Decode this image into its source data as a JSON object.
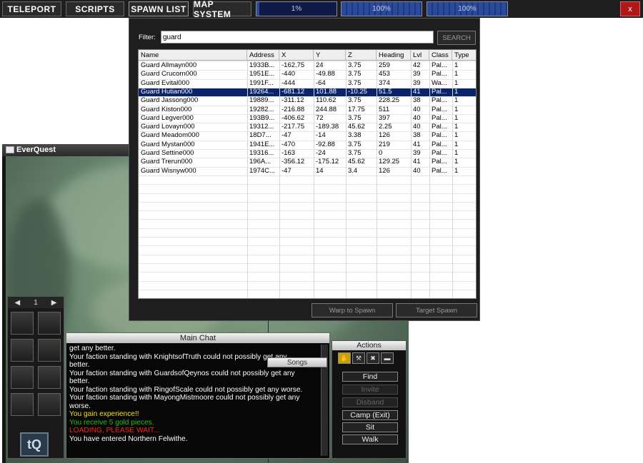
{
  "topbar": {
    "buttons": [
      "TELEPORT",
      "SCRIPTS",
      "SPAWN LIST",
      "MAP SYSTEM"
    ],
    "progress": [
      {
        "label": "1%",
        "value": 0.01
      },
      {
        "label": "100%",
        "value": 1.0
      },
      {
        "label": "100%",
        "value": 1.0
      }
    ],
    "close_label": "x"
  },
  "spawn_list": {
    "filter_label": "Filter:",
    "filter_value": "guard",
    "search_label": "SEARCH",
    "columns": [
      "Name",
      "Address",
      "X",
      "Y",
      "Z",
      "Heading",
      "Lvl",
      "Class",
      "Type"
    ],
    "selected_index": 3,
    "rows": [
      [
        "Guard Allmayn000",
        "1933B...",
        "-162.75",
        "24",
        "3.75",
        "259",
        "42",
        "Pal...",
        "1"
      ],
      [
        "Guard Crucorn000",
        "1951E...",
        "-440",
        "-49.88",
        "3.75",
        "453",
        "39",
        "Pal...",
        "1"
      ],
      [
        "Guard Evital000",
        "1991F...",
        "-444",
        "-64",
        "3.75",
        "374",
        "39",
        "Wa...",
        "1"
      ],
      [
        "Guard Hutian000",
        "19264...",
        "-681.12",
        "101.88",
        "-10.25",
        "51.5",
        "41",
        "Pal...",
        "1"
      ],
      [
        "Guard Jassong000",
        "19889...",
        "-311.12",
        "110.62",
        "3.75",
        "228.25",
        "38",
        "Pal...",
        "1"
      ],
      [
        "Guard Kiston000",
        "19282...",
        "-216.88",
        "244.88",
        "17.75",
        "511",
        "40",
        "Pal...",
        "1"
      ],
      [
        "Guard Legver000",
        "193B9...",
        "-406.62",
        "72",
        "3.75",
        "397",
        "40",
        "Pal...",
        "1"
      ],
      [
        "Guard Lovayn000",
        "19312...",
        "-217.75",
        "-189.38",
        "45.62",
        "2.25",
        "40",
        "Pal...",
        "1"
      ],
      [
        "Guard Meadom000",
        "18D7...",
        "-47",
        "-14",
        "3.38",
        "126",
        "38",
        "Pal...",
        "1"
      ],
      [
        "Guard Mystan000",
        "1941E...",
        "-470",
        "-92.88",
        "3.75",
        "219",
        "41",
        "Pal...",
        "1"
      ],
      [
        "Guard Settine000",
        "19316...",
        "-163",
        "-24",
        "3.75",
        "0",
        "39",
        "Pal...",
        "1"
      ],
      [
        "Guard Trerun000",
        "196A...",
        "-356.12",
        "-175.12",
        "45.62",
        "129.25",
        "41",
        "Pal...",
        "1"
      ],
      [
        "Guard Wisnyw000",
        "1974C...",
        "-47",
        "14",
        "3.4",
        "126",
        "40",
        "Pal...",
        "1"
      ]
    ],
    "warp_label": "Warp to Spawn",
    "target_label": "Target Spawn"
  },
  "game": {
    "title": "EverQuest",
    "inventory_page": "1",
    "logo_text": "tQ",
    "main_chat_title": "Main Chat",
    "songs_title": "Songs",
    "colors": {
      "white": "#ffffff",
      "yellow": "#f0e020",
      "green": "#20c020",
      "red": "#ff2020"
    },
    "chat_lines": [
      {
        "text": "get any better.",
        "color": "white"
      },
      {
        "text": "Your faction standing with KnightsofTruth could not possibly get any",
        "color": "white"
      },
      {
        "text": "better.",
        "color": "white"
      },
      {
        "text": "Your faction standing with GuardsofQeynos could not possibly get any",
        "color": "white"
      },
      {
        "text": "better.",
        "color": "white"
      },
      {
        "text": "Your faction standing with RingofScale could not possibly get any worse.",
        "color": "white"
      },
      {
        "text": "Your faction standing with MayongMistmoore could not possibly get any",
        "color": "white"
      },
      {
        "text": "worse.",
        "color": "white"
      },
      {
        "text": "You gain experience!!",
        "color": "yellow"
      },
      {
        "text": "You receive 5 gold pieces.",
        "color": "green"
      },
      {
        "text": "LOADING, PLEASE WAIT...",
        "color": "red"
      },
      {
        "text": "You have entered Northern Felwithe.",
        "color": "white"
      }
    ],
    "actions": {
      "title": "Actions",
      "buttons": [
        {
          "label": "Find",
          "enabled": true
        },
        {
          "label": "Invite",
          "enabled": false
        },
        {
          "label": "Disband",
          "enabled": false
        },
        {
          "label": "Camp (Exit)",
          "enabled": true
        },
        {
          "label": "Sit",
          "enabled": true
        },
        {
          "label": "Walk",
          "enabled": true
        }
      ]
    },
    "hotbar_icons": [
      "wolf-head-icon",
      "boot-icon",
      "shield-icon",
      "star-icon",
      "hand-icon",
      "eye-icon"
    ]
  }
}
